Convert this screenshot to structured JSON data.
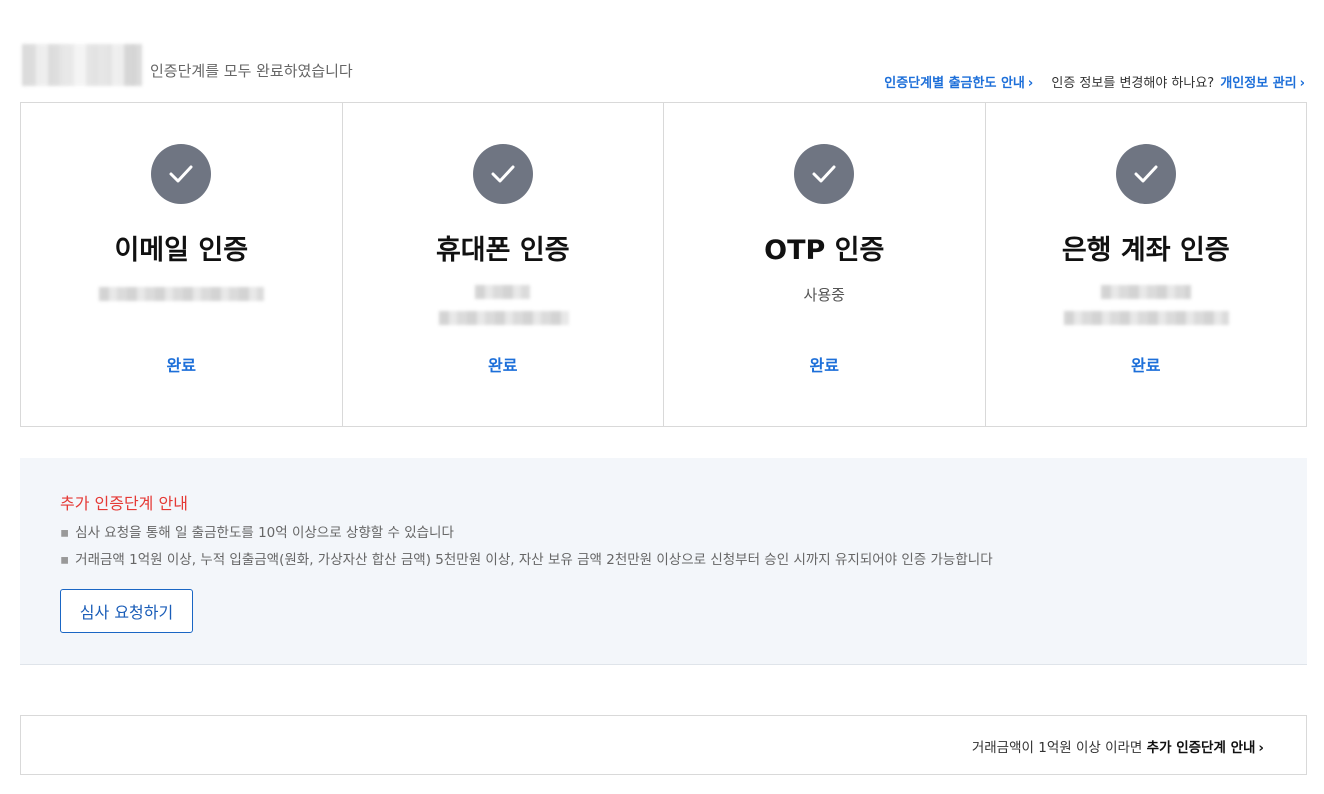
{
  "header": {
    "status_text": "인증단계를 모두 완료하였습니다",
    "limit_link": "인증단계별 출금한도 안내",
    "change_question": "인증 정보를 변경해야 하나요?",
    "personal_info_link": "개인정보 관리"
  },
  "cards": [
    {
      "title": "이메일 인증",
      "value": "",
      "status": "완료"
    },
    {
      "title": "휴대폰 인증",
      "value": "",
      "status": "완료"
    },
    {
      "title": "OTP 인증",
      "value": "사용중",
      "status": "완료"
    },
    {
      "title": "은행 계좌 인증",
      "value": "",
      "status": "완료"
    }
  ],
  "info": {
    "title": "추가 인증단계 안내",
    "items": [
      "심사 요청을 통해 일 출금한도를 10억 이상으로 상향할 수 있습니다",
      "거래금액 1억원 이상, 누적 입출금액(원화, 가상자산 합산 금액) 5천만원 이상, 자산 보유 금액 2천만원 이상으로 신청부터 승인 시까지 유지되어야 인증 가능합니다"
    ],
    "button_label": "심사 요청하기"
  },
  "bottom": {
    "prefix": "거래금액이 1억원 이상 이라면",
    "link": "추가 인증단계 안내"
  },
  "colors": {
    "accent_blue": "#1d6fd9",
    "alert_red": "#e53935",
    "check_gray": "#6f7582",
    "info_bg": "#f3f6fa"
  },
  "icons": {
    "check": "check-circle-icon",
    "chevron": "chevron-right-icon"
  }
}
